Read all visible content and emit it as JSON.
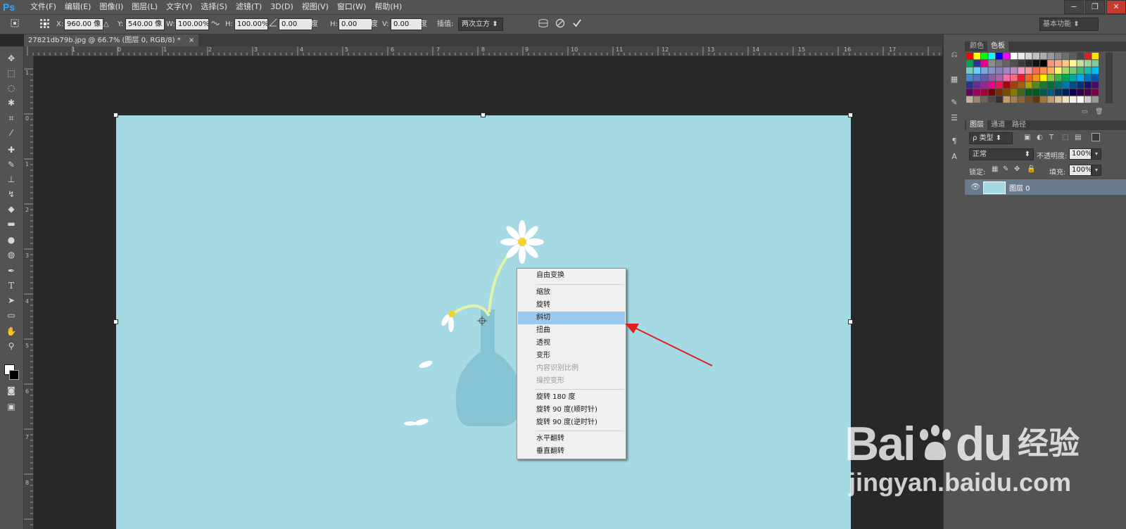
{
  "app": {
    "logo": "Ps"
  },
  "menu": [
    "文件(F)",
    "编辑(E)",
    "图像(I)",
    "图层(L)",
    "文字(Y)",
    "选择(S)",
    "滤镜(T)",
    "3D(D)",
    "视图(V)",
    "窗口(W)",
    "帮助(H)"
  ],
  "window_controls": {
    "minimize": "−",
    "restore": "❐",
    "close": "✕"
  },
  "options": {
    "x_label": "X:",
    "x_value": "960.00 像",
    "delta_icon": "△",
    "y_label": "Y:",
    "y_value": "540.00 像",
    "w_label": "W:",
    "w_value": "100.00%",
    "h_label": "H:",
    "h_value": "100.00%",
    "angle_value": "0.00",
    "angle_unit": "度",
    "hskew_label": "H:",
    "hskew_value": "0.00",
    "hskew_unit": "度",
    "vskew_label": "V:",
    "vskew_value": "0.00",
    "vskew_unit": "度",
    "interp_label": "插值:",
    "interp_value": "两次立方",
    "workspace": "基本功能"
  },
  "document": {
    "tab_title": "27821db79b.jpg @ 66.7% (图层 0, RGB/8) *",
    "tab_close": "×"
  },
  "ruler": {
    "top": [
      "1",
      "0",
      "1",
      "2",
      "3",
      "4",
      "5",
      "6",
      "7",
      "8",
      "9",
      "10",
      "11",
      "12",
      "13",
      "14",
      "15",
      "16",
      "17"
    ],
    "left": [
      "1",
      "0",
      "1",
      "2",
      "3",
      "4",
      "5",
      "6",
      "7",
      "8"
    ]
  },
  "context_menu": {
    "items": [
      {
        "label": "自由变换",
        "state": "normal"
      },
      {
        "label": "缩放",
        "state": "normal"
      },
      {
        "label": "旋转",
        "state": "normal"
      },
      {
        "label": "斜切",
        "state": "highlight"
      },
      {
        "label": "扭曲",
        "state": "normal"
      },
      {
        "label": "透视",
        "state": "normal"
      },
      {
        "label": "变形",
        "state": "normal"
      },
      {
        "label": "内容识别比例",
        "state": "disabled"
      },
      {
        "label": "操控变形",
        "state": "disabled"
      },
      {
        "label": "旋转 180 度",
        "state": "normal"
      },
      {
        "label": "旋转 90 度(顺时针)",
        "state": "normal"
      },
      {
        "label": "旋转 90 度(逆时针)",
        "state": "normal"
      },
      {
        "label": "水平翻转",
        "state": "normal"
      },
      {
        "label": "垂直翻转",
        "state": "normal"
      }
    ]
  },
  "panels": {
    "color_tabs": [
      "颜色",
      "色板"
    ],
    "layer_tabs": [
      "图层",
      "通道",
      "路径"
    ],
    "kind_filter": "ρ 类型",
    "blend_mode": "正常",
    "opacity_label": "不透明度:",
    "opacity_value": "100%",
    "lock_label": "锁定:",
    "fill_label": "填充:",
    "fill_value": "100%",
    "layer_name": "图层 0"
  },
  "colors": {
    "canvas": "#a5d9e3",
    "vase": "#86c3d3",
    "highlight": "#99c9ef",
    "arrow": "#e01f1f"
  },
  "watermark": {
    "brand": "Bai",
    "brand_tail": "du",
    "suffix": "经验",
    "url": "jingyan.baidu.com"
  }
}
